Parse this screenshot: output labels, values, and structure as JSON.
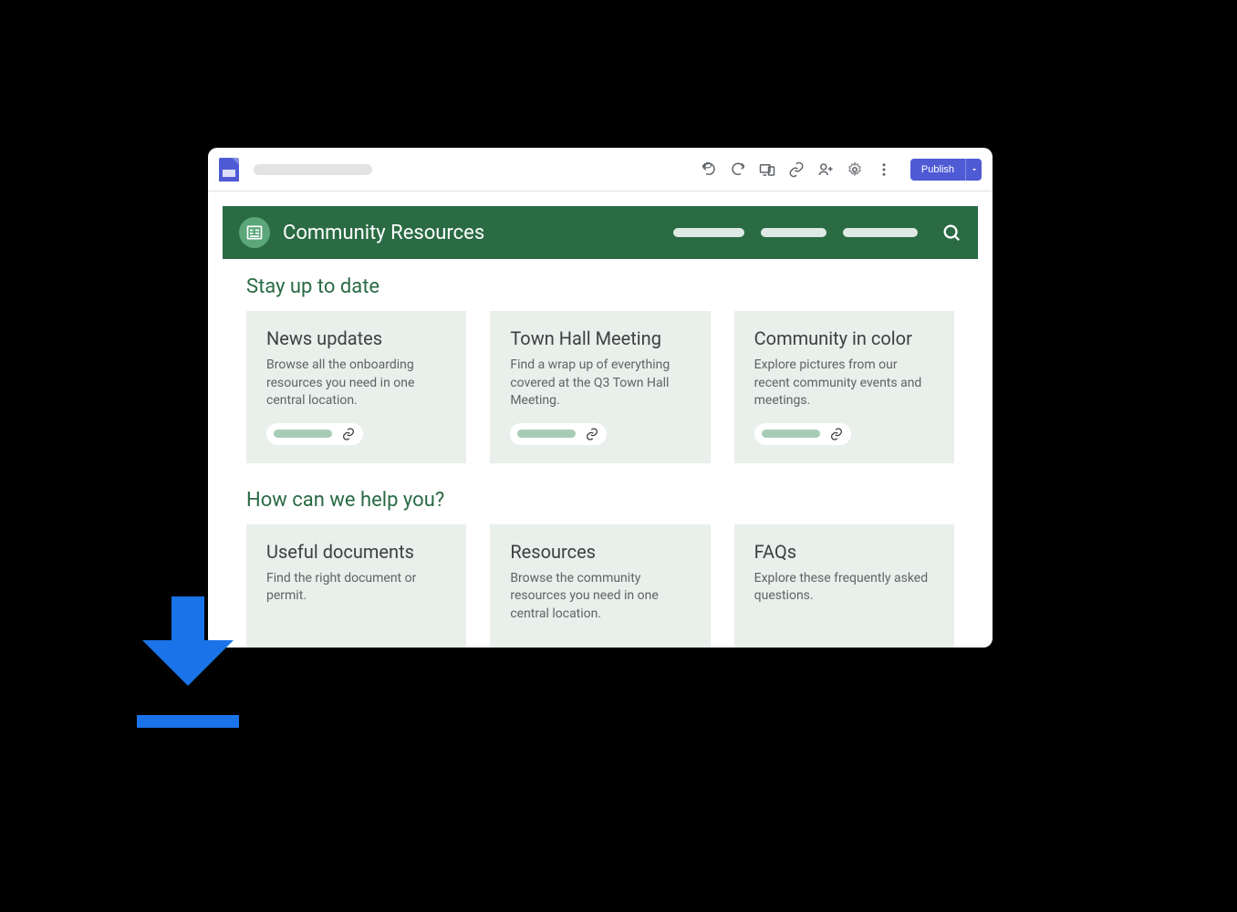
{
  "toolbar": {
    "publish_label": "Publish"
  },
  "site": {
    "title": "Community Resources"
  },
  "sections": [
    {
      "title": "Stay up to date",
      "cards": [
        {
          "title": "News updates",
          "desc": "Browse all the onboarding resources you need in one central location."
        },
        {
          "title": "Town Hall Meeting",
          "desc": "Find a wrap up of everything covered at the Q3 Town Hall Meeting."
        },
        {
          "title": "Community in color",
          "desc": "Explore pictures from our recent community events and meetings."
        }
      ]
    },
    {
      "title": "How can we help you?",
      "cards": [
        {
          "title": "Useful documents",
          "desc": "Find the right document or permit."
        },
        {
          "title": "Resources",
          "desc": "Browse the community resources you need in one central location."
        },
        {
          "title": "FAQs",
          "desc": "Explore these frequently asked questions."
        }
      ]
    }
  ]
}
